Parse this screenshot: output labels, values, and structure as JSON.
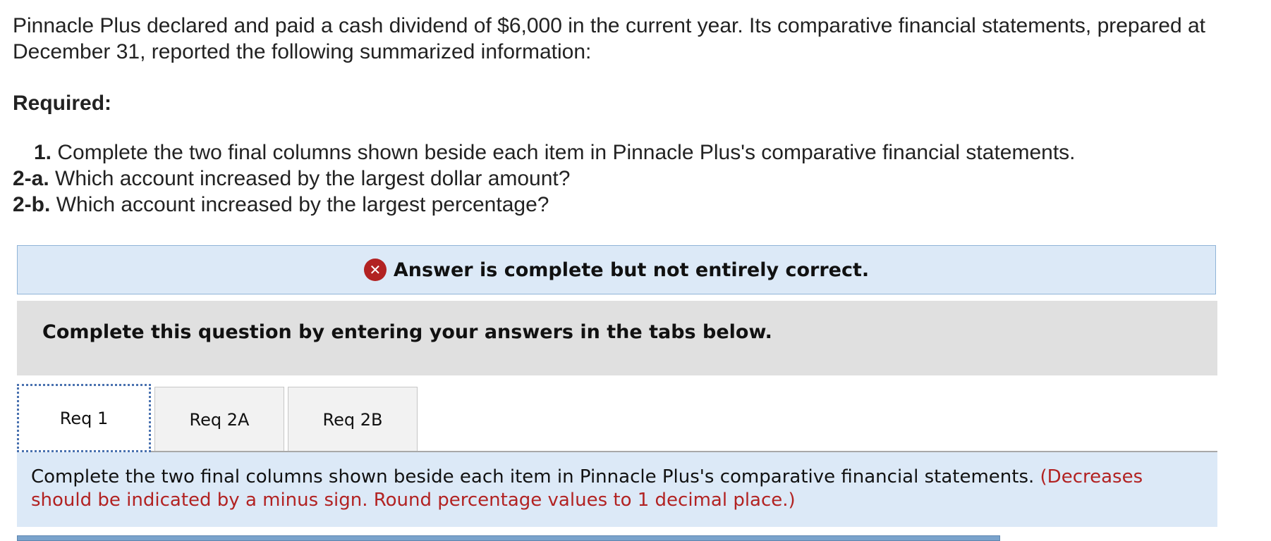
{
  "intro": {
    "line1": "Pinnacle Plus declared and paid a cash dividend of $6,000 in the current year. Its comparative financial statements, prepared at",
    "line2": "December 31, reported the following summarized information:"
  },
  "required": {
    "heading": "Required:",
    "items": [
      {
        "num": "1.",
        "text": "Complete the two final columns shown beside each item in Pinnacle Plus's comparative financial statements."
      },
      {
        "num": "2-a.",
        "text": "Which account increased by the largest dollar amount?"
      },
      {
        "num": "2-b.",
        "text": "Which account increased by the largest percentage?"
      }
    ]
  },
  "feedback": {
    "icon": "x-circle-icon",
    "text": "Answer is complete but not entirely correct.",
    "color": "#b22222"
  },
  "instruction": {
    "text": "Complete this question by entering your answers in the tabs below."
  },
  "tabs": [
    {
      "label": "Req 1",
      "active": true
    },
    {
      "label": "Req 2A",
      "active": false
    },
    {
      "label": "Req 2B",
      "active": false
    }
  ],
  "content": {
    "text": "Complete the two final columns shown beside each item in Pinnacle Plus's comparative financial statements. ",
    "note": "(Decreases should be indicated by a minus sign. Round percentage values to 1 decimal place.)"
  },
  "colors": {
    "banner_bg": "#dce9f7",
    "instruction_bg": "#e0e0e0",
    "error_red": "#b22222",
    "tab_focus_border": "#4a72b0"
  }
}
